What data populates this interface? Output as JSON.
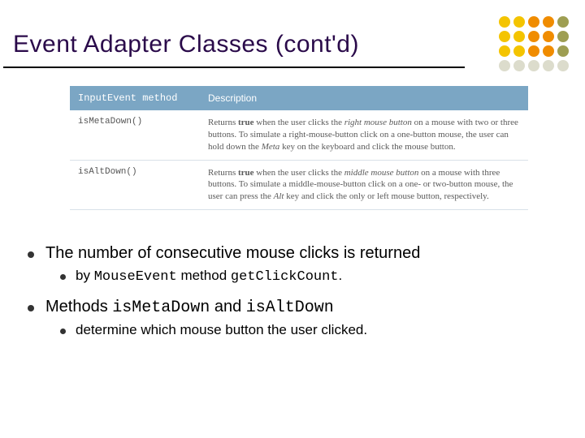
{
  "title": "Event Adapter Classes (cont'd)",
  "dot_colors": [
    "#f4c400",
    "#f4c400",
    "#f08c00",
    "#f08c00",
    "#9e9e52",
    "#f4c400",
    "#f4c400",
    "#f08c00",
    "#f08c00",
    "#9e9e52",
    "#f4c400",
    "#f4c400",
    "#f08c00",
    "#f08c00",
    "#9e9e52",
    "#dcdccc",
    "#dcdccc",
    "#dcdccc",
    "#dcdccc",
    "#dcdccc"
  ],
  "table": {
    "head": {
      "method": "InputEvent method",
      "desc": "Description"
    },
    "rows": [
      {
        "method": "isMetaDown()",
        "desc_html": "Returns <span class=\"kw\">true</span> when the user clicks the <em>right mouse button</em> on a mouse with two or three buttons. To simulate a right-mouse-button click on a one-button mouse, the user can hold down the <em>Meta</em> key on the keyboard and click the mouse button."
      },
      {
        "method": "isAltDown()",
        "desc_html": "Returns <span class=\"kw\">true</span> when the user clicks the <em>middle mouse button</em> on a mouse with three buttons. To simulate a middle-mouse-button click on a one- or two-button mouse, the user can press the <em>Alt</em> key and click the only or left mouse button, respectively."
      }
    ]
  },
  "bullets": {
    "b1a": "The number of consecutive mouse clicks is returned",
    "b1a_sub_prefix": "by ",
    "b1a_sub_code1": "MouseEvent",
    "b1a_sub_mid": " method ",
    "b1a_sub_code2": "getClickCount",
    "b1a_sub_suffix": ".",
    "b1b_prefix": "Methods ",
    "b1b_code1": "isMetaDown",
    "b1b_mid": " and ",
    "b1b_code2": "isAltDown",
    "b1b_sub": "determine which mouse button the user clicked."
  }
}
